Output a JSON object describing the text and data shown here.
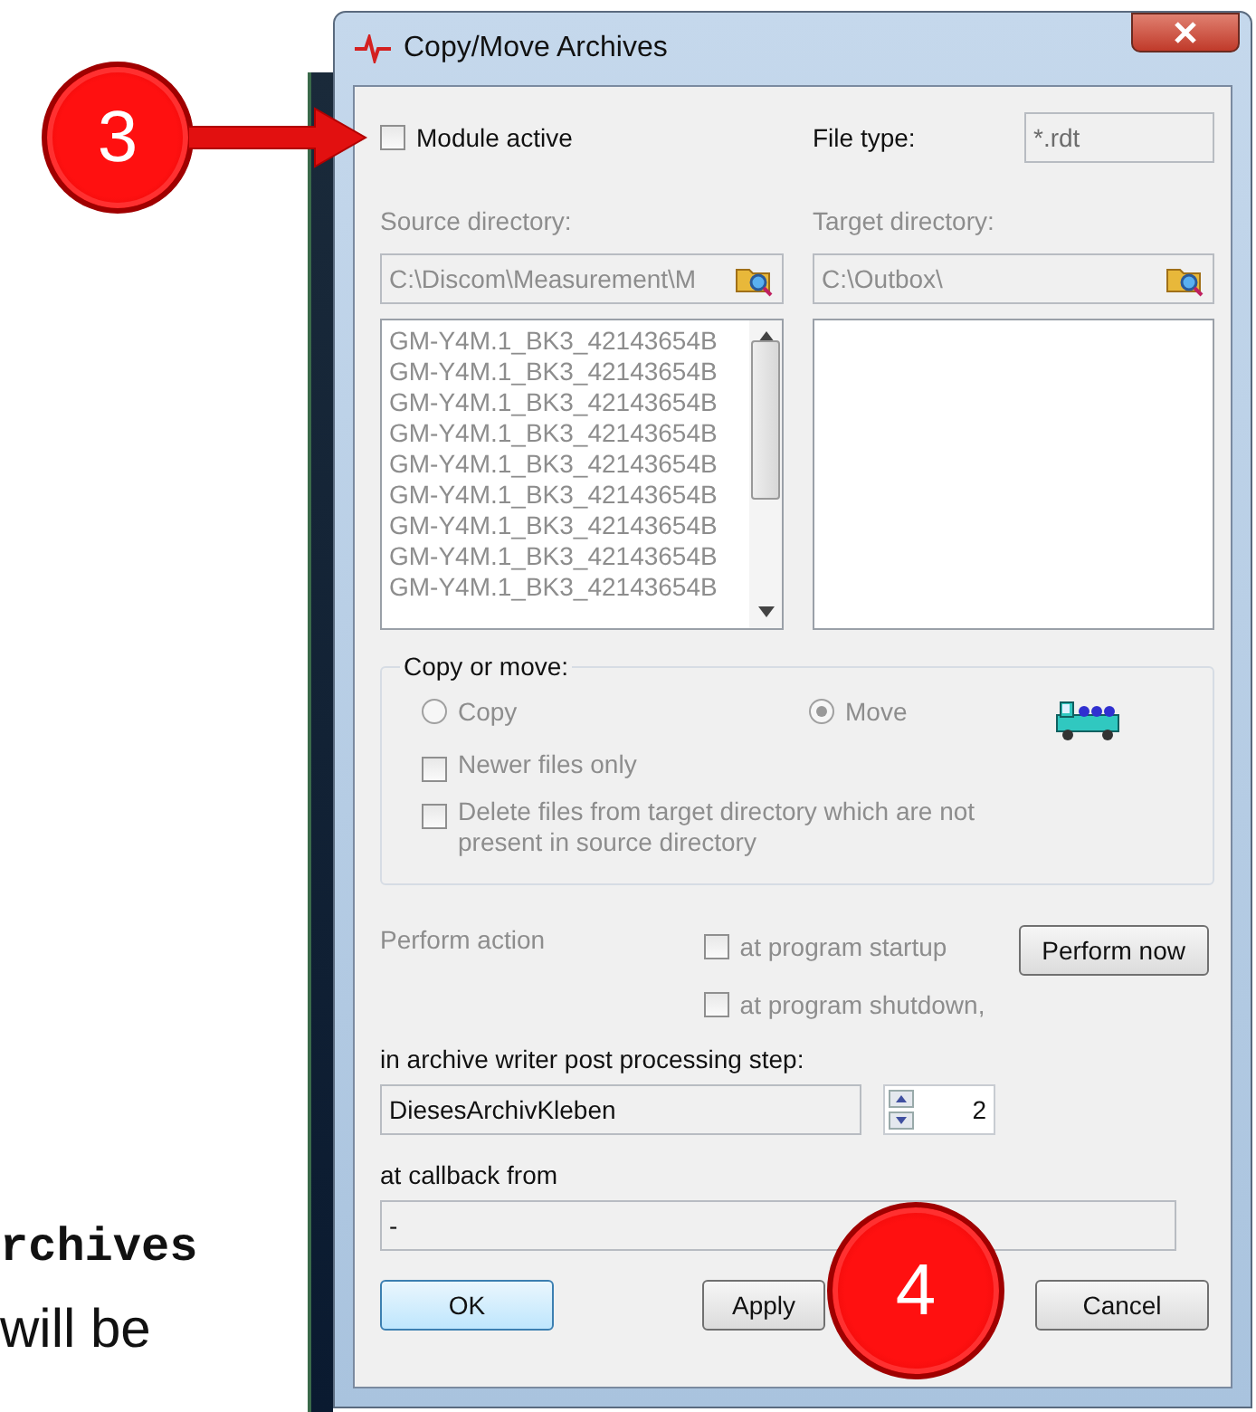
{
  "annotations": [
    {
      "kind": "arrow",
      "label": "3"
    },
    {
      "kind": "circle",
      "label": "4"
    }
  ],
  "background_text": [
    {
      "kind": "code",
      "text": "rchives"
    },
    {
      "kind": "plain",
      "text": "will be"
    }
  ],
  "window": {
    "title": "Copy/Move Archives"
  },
  "module_active": {
    "label": "Module active",
    "checked": false
  },
  "file_type": {
    "label": "File type:",
    "value": "*.rdt"
  },
  "source": {
    "label": "Source directory:",
    "value": "C:\\Discom\\Measurement\\M",
    "disabled": true,
    "files": [
      "GM-Y4M.1_BK3_42143654B",
      "GM-Y4M.1_BK3_42143654B",
      "GM-Y4M.1_BK3_42143654B",
      "GM-Y4M.1_BK3_42143654B",
      "GM-Y4M.1_BK3_42143654B",
      "GM-Y4M.1_BK3_42143654B",
      "GM-Y4M.1_BK3_42143654B",
      "GM-Y4M.1_BK3_42143654B",
      "GM-Y4M.1_BK3_42143654B"
    ]
  },
  "target": {
    "label": "Target directory:",
    "value": "C:\\Outbox\\",
    "disabled": true
  },
  "copy_or_move": {
    "title": "Copy or move:",
    "disabled": true,
    "options": [
      {
        "label": "Copy",
        "selected": false
      },
      {
        "label": "Move",
        "selected": true
      }
    ],
    "checkboxes": [
      {
        "label": "Newer files only",
        "checked": false
      },
      {
        "label": "Delete files from target directory which are not present in source directory",
        "checked": false
      }
    ]
  },
  "perform": {
    "label": "Perform action",
    "disabled": true,
    "checkboxes": [
      {
        "label": "at program startup",
        "checked": false
      },
      {
        "label": "at program shutdown,",
        "checked": false
      }
    ],
    "button": "Perform now"
  },
  "post_processing": {
    "label": "in archive writer post processing step:",
    "value": "DiesesArchivKleben",
    "step": "2"
  },
  "callback": {
    "label": "at callback from",
    "value": "-"
  },
  "buttons": [
    {
      "label": "OK",
      "default": true
    },
    {
      "label": "Apply",
      "default": false
    },
    {
      "label": "Cancel",
      "default": false
    }
  ]
}
